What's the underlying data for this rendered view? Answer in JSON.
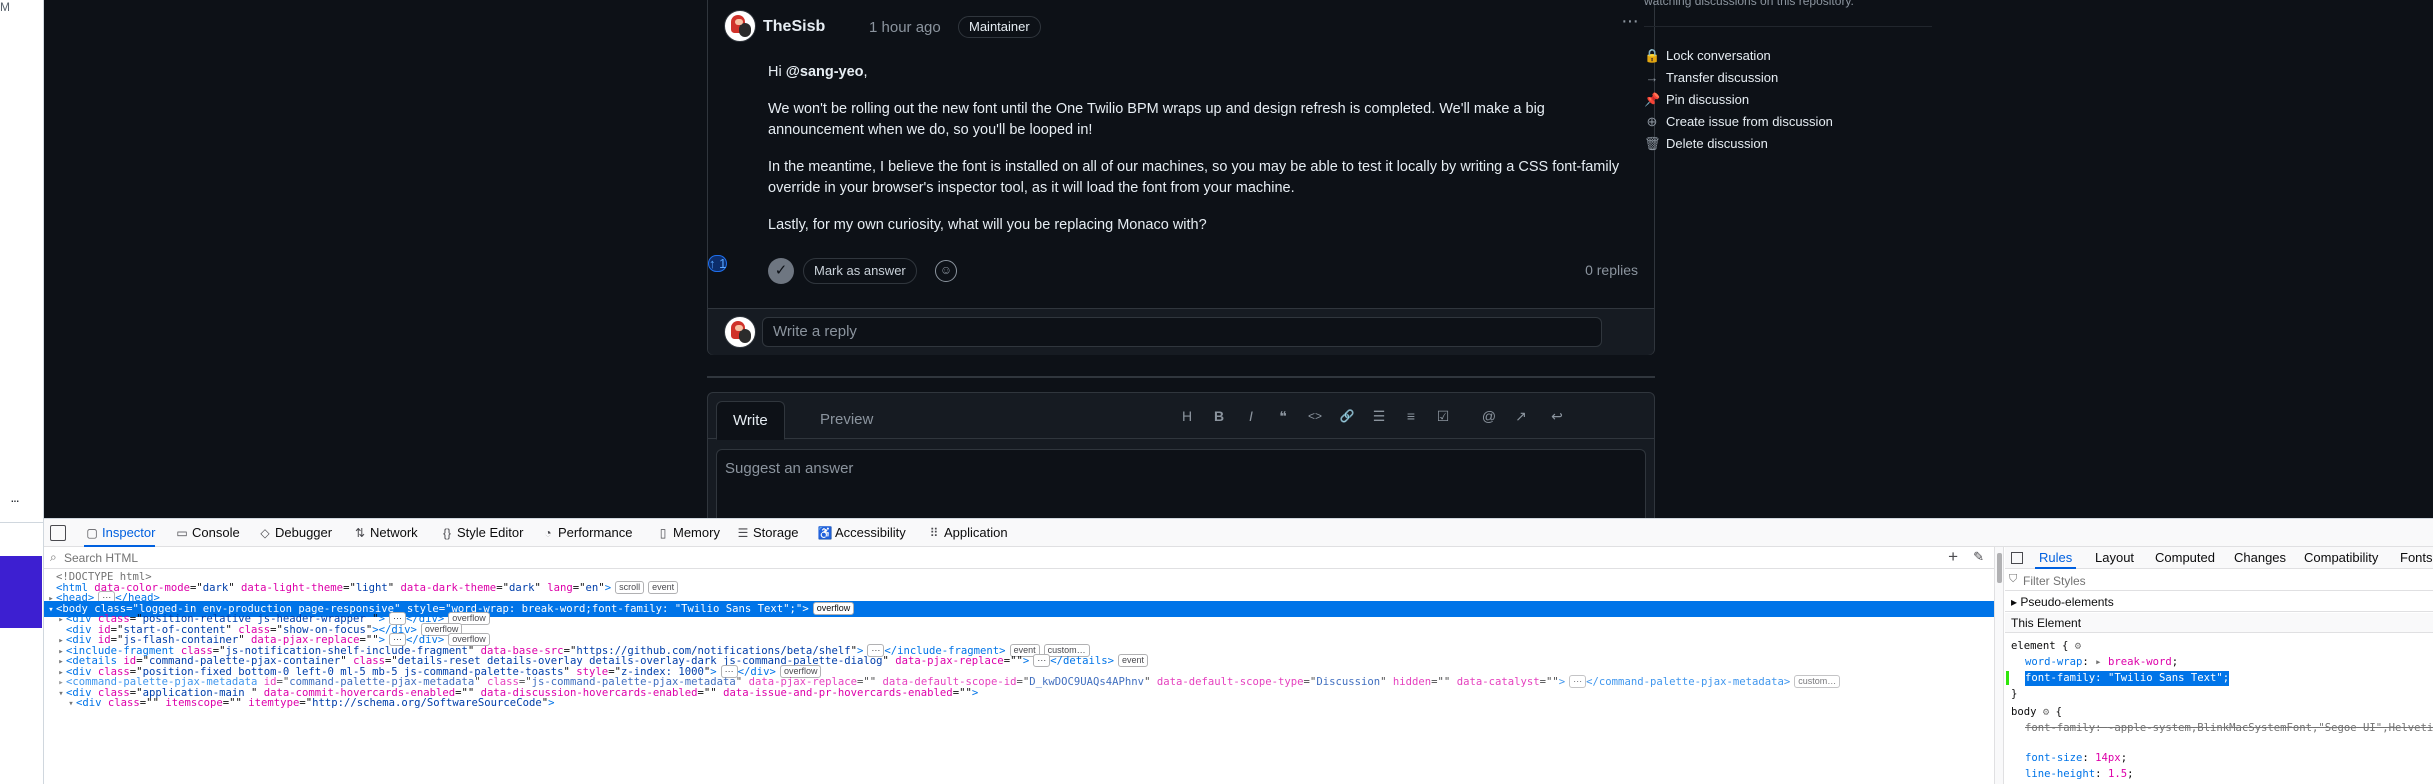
{
  "left_strip": {
    "m_label": "M",
    "more_label": "···"
  },
  "comment": {
    "author": "TheSisb",
    "time": "1 hour ago",
    "role": "Maintainer",
    "more_label": "···",
    "body": {
      "greeting_prefix": "Hi ",
      "mention": "@sang-yeo",
      "greeting_suffix": ",",
      "p1": "We won't be rolling out the new font until the One Twilio BPM wraps up and design refresh is completed. We'll make a big announcement when we do, so you'll be looped in!",
      "p2": "In the meantime, I believe the font is installed on all of our machines, so you may be able to test it locally by writing a CSS font-family override in your browser's inspector tool, as it will load the font from your machine.",
      "p3": "Lastly, for my own curiosity, what will you be replacing Monaco with?"
    },
    "mark_as_answer": "Mark as answer",
    "upvote_arrow": "↑",
    "upvote_count": "1",
    "replies": "0 replies",
    "reply_placeholder": "Write a reply"
  },
  "editor": {
    "tab_write": "Write",
    "tab_preview": "Preview",
    "placeholder": "Suggest an answer",
    "toolbar": [
      {
        "name": "heading",
        "glyph": "H"
      },
      {
        "name": "bold",
        "glyph": "B"
      },
      {
        "name": "italic",
        "glyph": "I"
      },
      {
        "name": "quote",
        "glyph": "❝"
      },
      {
        "name": "code",
        "glyph": "<>"
      },
      {
        "name": "link",
        "glyph": "🔗"
      },
      {
        "name": "unordered-list",
        "glyph": "☰"
      },
      {
        "name": "ordered-list",
        "glyph": "≡"
      },
      {
        "name": "task-list",
        "glyph": "☑"
      },
      {
        "name": "mention",
        "glyph": "@"
      },
      {
        "name": "cross-reference",
        "glyph": "↗"
      },
      {
        "name": "saved-replies",
        "glyph": "↩"
      }
    ]
  },
  "sidebar": {
    "top_text": "watching discussions on this repository.",
    "items": [
      {
        "icon": "lock-icon",
        "glyph": "🔒",
        "label": "Lock conversation"
      },
      {
        "icon": "arrow-right-icon",
        "glyph": "→",
        "label": "Transfer discussion"
      },
      {
        "icon": "pin-icon",
        "glyph": "📌",
        "label": "Pin discussion"
      },
      {
        "icon": "issue-opened-icon",
        "glyph": "⊕",
        "label": "Create issue from discussion"
      },
      {
        "icon": "trash-icon",
        "glyph": "🗑",
        "label": "Delete discussion"
      }
    ]
  },
  "devtools": {
    "tabs": [
      {
        "name": "inspector",
        "glyph": "▢",
        "label": "Inspector",
        "active": true
      },
      {
        "name": "console",
        "glyph": "▭",
        "label": "Console"
      },
      {
        "name": "debugger",
        "glyph": "◇",
        "label": "Debugger"
      },
      {
        "name": "network",
        "glyph": "⇅",
        "label": "Network"
      },
      {
        "name": "style-editor",
        "glyph": "{}",
        "label": "Style Editor"
      },
      {
        "name": "performance",
        "glyph": "◔",
        "label": "Performance"
      },
      {
        "name": "memory",
        "glyph": "▯",
        "label": "Memory"
      },
      {
        "name": "storage",
        "glyph": "☰",
        "label": "Storage"
      },
      {
        "name": "accessibility",
        "glyph": "♿",
        "label": "Accessibility"
      },
      {
        "name": "application",
        "glyph": "⠿",
        "label": "Application"
      }
    ],
    "search_placeholder": "Search HTML",
    "plus_label": "+",
    "markup": {
      "doctype": "<!DOCTYPE html>",
      "html_line": {
        "open": "<html",
        "attrs": [
          [
            "data-color-mode",
            "dark"
          ],
          [
            "data-light-theme",
            "light"
          ],
          [
            "data-dark-theme",
            "dark"
          ],
          [
            "lang",
            "en"
          ]
        ],
        "close": ">",
        "badges": [
          "scroll",
          "event"
        ]
      },
      "head_line": "<head>",
      "head_close": "</head>",
      "body_line": {
        "open": "<body",
        "attrs": [
          [
            "class",
            "logged-in env-production page-responsive"
          ],
          [
            "style",
            "word-wrap: break-word;font-family: \"Twilio Sans Text\";"
          ]
        ],
        "close": ">",
        "badges": [
          "overflow"
        ]
      },
      "children": [
        {
          "text_open": "<div",
          "attrs": [
            [
              "class",
              "position-relative js-header-wrapper "
            ]
          ],
          "tail": "></div>",
          "collapsed": true,
          "badges": [
            "overflow"
          ]
        },
        {
          "text_open": "<div",
          "attrs": [
            [
              "id",
              "start-of-content"
            ],
            [
              "class",
              "show-on-focus"
            ]
          ],
          "tail": "></div>",
          "collapsed": false,
          "leaf": true,
          "badges": [
            "overflow"
          ]
        },
        {
          "text_open": "<div",
          "attrs": [
            [
              "id",
              "js-flash-container"
            ],
            [
              "data-pjax-replace",
              ""
            ]
          ],
          "tail": "></div>",
          "collapsed": true,
          "badges": [
            "overflow"
          ]
        },
        {
          "text_open": "<include-fragment",
          "attrs": [
            [
              "class",
              "js-notification-shelf-include-fragment"
            ],
            [
              "data-base-src",
              "https://github.com/notifications/beta/shelf"
            ]
          ],
          "tail": "></include-fragment>",
          "collapsed": true,
          "badges": [
            "event",
            "custom…"
          ]
        },
        {
          "text_open": "<details",
          "attrs": [
            [
              "id",
              "command-palette-pjax-container"
            ],
            [
              "class",
              "details-reset details-overlay details-overlay-dark js-command-palette-dialog"
            ],
            [
              "data-pjax-replace",
              ""
            ]
          ],
          "tail": "></details>",
          "collapsed": true,
          "badges": [
            "event"
          ]
        },
        {
          "text_open": "<div",
          "attrs": [
            [
              "class",
              "position-fixed bottom-0 left-0 ml-5 mb-5 js-command-palette-toasts"
            ],
            [
              "style",
              "z-index: 1000"
            ]
          ],
          "tail": "></div>",
          "collapsed": true,
          "badges": [
            "overflow"
          ]
        },
        {
          "text_open": "<command-palette-pjax-metadata",
          "attrs": [
            [
              "id",
              "command-palette-pjax-metadata"
            ],
            [
              "class",
              "js-command-palette-pjax-metadata"
            ],
            [
              "data-pjax-replace",
              ""
            ],
            [
              "data-default-scope-id",
              "D_kwDOC9UAQs4APhnv"
            ],
            [
              "data-default-scope-type",
              "Discussion"
            ],
            [
              "hidden",
              ""
            ],
            [
              "data-catalyst",
              ""
            ]
          ],
          "tail": "></command-palette-pjax-metadata>",
          "collapsed": true,
          "dim": true,
          "badges": [
            "custom…"
          ]
        },
        {
          "text_open": "<div",
          "attrs": [
            [
              "class",
              "application-main "
            ],
            [
              "data-commit-hovercards-enabled",
              ""
            ],
            [
              "data-discussion-hovercards-enabled",
              ""
            ],
            [
              "data-issue-and-pr-hovercards-enabled",
              ""
            ]
          ],
          "tail": ">",
          "expanded": true,
          "badges": []
        },
        {
          "text_open": "<div",
          "attrs": [
            [
              "class",
              ""
            ],
            [
              "itemscope",
              ""
            ],
            [
              "itemtype",
              "http://schema.org/SoftwareSourceCode"
            ]
          ],
          "tail": ">",
          "expanded": true,
          "indent2": true,
          "badges": []
        }
      ]
    },
    "rules_panel": {
      "tabs": [
        "Rules",
        "Layout",
        "Computed",
        "Changes",
        "Compatibility",
        "Fonts"
      ],
      "filter_placeholder": "Filter Styles",
      "pseudo_elements": "Pseudo-elements",
      "this_element": "This Element",
      "element_selector": "element {",
      "element_rules": [
        {
          "prop": "word-wrap",
          "value": "break-word"
        },
        {
          "prop": "font-family",
          "value": "\"Twilio Sans Text\"",
          "highlight": true
        }
      ],
      "close_brace": "}",
      "body_selector": "body",
      "body_rules": [
        {
          "prop": "font-family",
          "value": "-apple-system,BlinkMacSystemFont,\"Segoe UI\",Helvetica,Arial,sans-serif,\"Apple Color Emoji\",\"Segoe UI Emoji\"",
          "struck": true
        },
        {
          "prop": "font-size",
          "value": "14px"
        },
        {
          "prop": "line-height",
          "value": "1.5"
        }
      ]
    }
  }
}
